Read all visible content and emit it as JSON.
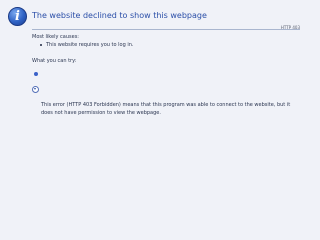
{
  "page": {
    "title": "The website declined to show this webpage",
    "error_code": "HTTP 403"
  },
  "causes": {
    "heading": "Most likely causes:",
    "items": [
      "This website requires you to log in."
    ]
  },
  "try": {
    "heading": "What you can try:"
  },
  "details": {
    "text": "This error (HTTP 403 Forbidden) means that this program was able to connect to the website, but it does not have permission to view the webpage."
  },
  "colors": {
    "title": "#2b4fa8",
    "background": "#f0f2f8",
    "rule": "#a9b6cf",
    "icon": "#2f62c4"
  },
  "icons": {
    "main": "info-icon",
    "toggle": "chevron-down-icon"
  }
}
